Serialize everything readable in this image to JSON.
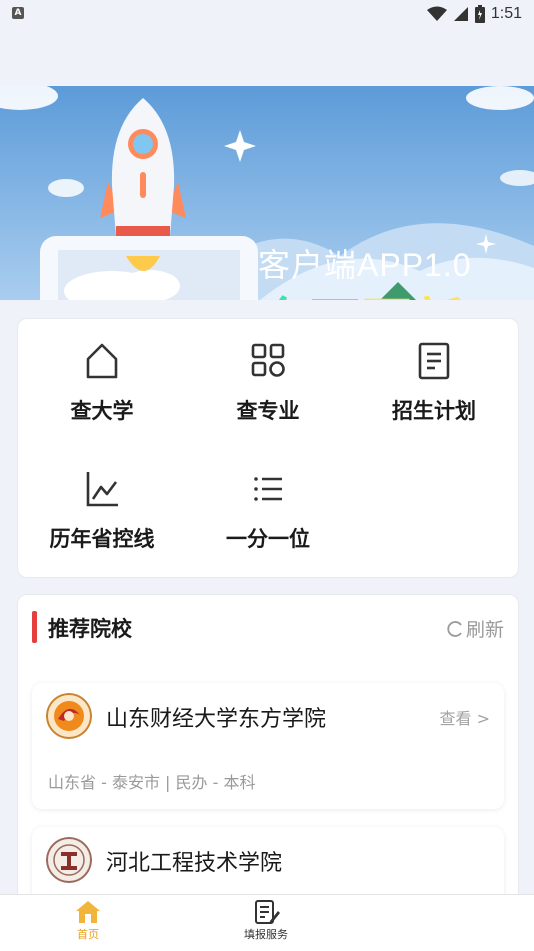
{
  "status_bar": {
    "left_badge": "A",
    "time": "1:51",
    "icons": [
      "wifi-icon",
      "signal-icon",
      "battery-icon"
    ]
  },
  "banner": {
    "line1": "客户端APP1.0",
    "line2_part1": "全面",
    "line2_part2": "更新"
  },
  "menu": {
    "items": [
      {
        "label": "查大学",
        "icon": "home-icon"
      },
      {
        "label": "查专业",
        "icon": "grid-icon"
      },
      {
        "label": "招生计划",
        "icon": "document-icon"
      },
      {
        "label": "历年省控线",
        "icon": "line-chart-icon"
      },
      {
        "label": "一分一位",
        "icon": "list-icon"
      }
    ]
  },
  "recommend": {
    "title": "推荐院校",
    "refresh_label": "刷新",
    "schools": [
      {
        "name": "山东财经大学东方学院",
        "view_label": "查看 >",
        "meta": "山东省 - 泰安市 | 民办 - 本科"
      },
      {
        "name": "河北工程技术学院"
      }
    ]
  },
  "bottom_nav": {
    "items": [
      {
        "label": "首页",
        "icon": "home-icon",
        "active": true
      },
      {
        "label": "填报服务",
        "icon": "edit-form-icon",
        "active": false
      }
    ]
  },
  "colors": {
    "accent": "#e63d3d",
    "nav_active": "#e6a21e",
    "banner_green": "#41e0b4",
    "banner_yellow": "#ffe34a"
  }
}
